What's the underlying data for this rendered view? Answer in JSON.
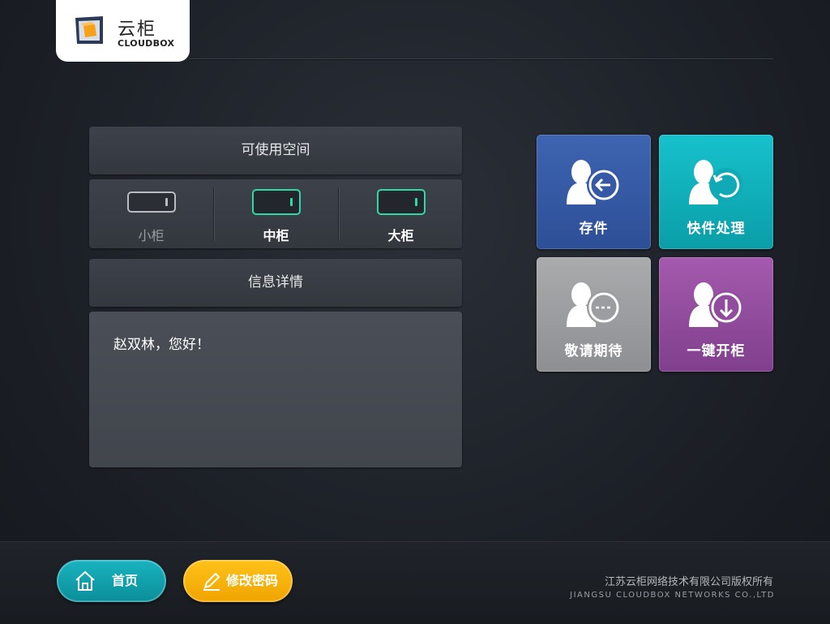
{
  "brand": {
    "name_cn": "云柜",
    "name_en": "CLOUDBOX",
    "accent": "#f7a11a"
  },
  "space_panel": {
    "title": "可使用空间",
    "cabinets": [
      {
        "label": "小柜",
        "available": false
      },
      {
        "label": "中柜",
        "available": true
      },
      {
        "label": "大柜",
        "available": true
      }
    ],
    "available_color": "#2fd8a6"
  },
  "info_panel": {
    "title": "信息详情",
    "greeting": "赵双林，您好！"
  },
  "tiles": [
    {
      "label": "存件",
      "icon": "user-deposit-icon",
      "color": "#3559a6"
    },
    {
      "label": "快件处理",
      "icon": "user-refresh-icon",
      "color": "#10b1bc"
    },
    {
      "label": "敬请期待",
      "icon": "user-pending-icon",
      "color": "#9b9da0"
    },
    {
      "label": "一键开柜",
      "icon": "user-download-icon",
      "color": "#924c9d"
    }
  ],
  "footer": {
    "home_label": "首页",
    "password_label": "修改密码",
    "copyright_cn": "江苏云柜网络技术有限公司版权所有",
    "copyright_en": "JIANGSU CLOUDBOX NETWORKS CO.,LTD"
  }
}
